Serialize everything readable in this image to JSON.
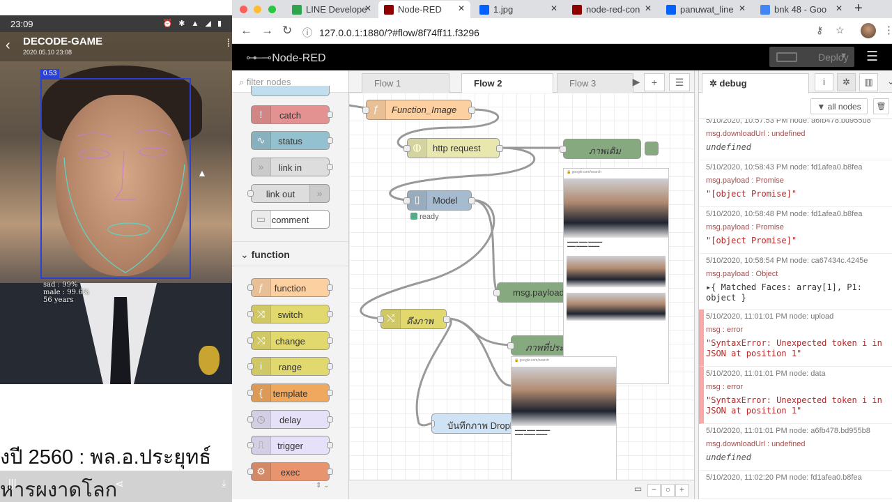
{
  "phone": {
    "time": "23:09",
    "status_icons": "⏰ ✱ ▲ ◢ ▮",
    "app_title": "DECODE-GAME",
    "app_date": "2020.05.10 23:08",
    "confidence": "0.53",
    "stats": [
      "sad : 99%",
      "male : 99.6%",
      "56 years"
    ],
    "caption_line1": "งปี 2560 : พล.อ.ประยุทธ์",
    "caption_line2": "หารผงาดโลก"
  },
  "browser": {
    "tabs": [
      {
        "label": "LINE Develope",
        "color": "#2fa44f",
        "fav": "</>"
      },
      {
        "label": "Node-RED",
        "color": "#8f0000",
        "fav": ""
      },
      {
        "label": "1.jpg",
        "color": "#0061fe",
        "fav": ""
      },
      {
        "label": "node-red-con",
        "color": "#8f0000",
        "fav": ""
      },
      {
        "label": "panuwat_line",
        "color": "#0061fe",
        "fav": ""
      },
      {
        "label": "bnk 48 - Goo",
        "color": "#4285f4",
        "fav": "G"
      }
    ],
    "url": "127.0.0.1:1880/?#flow/8f74ff11.f3296"
  },
  "nodered": {
    "logo": "Node-RED",
    "deploy": "Deploy",
    "filter_placeholder": "filter nodes",
    "category": "function",
    "palette": [
      {
        "label": "catch",
        "color": "#e49191",
        "icon": "!"
      },
      {
        "label": "status",
        "color": "#94c1d0",
        "icon": "∿"
      },
      {
        "label": "link in",
        "color": "#dddddd",
        "icon": "»"
      },
      {
        "label": "link out",
        "color": "#dddddd",
        "icon": "»"
      },
      {
        "label": "comment",
        "color": "#ffffff",
        "icon": "▭"
      },
      {
        "label": "function",
        "color": "#fdd0a2",
        "icon": "ƒ"
      },
      {
        "label": "switch",
        "color": "#e2d96e",
        "icon": "⤨"
      },
      {
        "label": "change",
        "color": "#e2d96e",
        "icon": "⤭"
      },
      {
        "label": "range",
        "color": "#e2d96e",
        "icon": "i"
      },
      {
        "label": "template",
        "color": "#f0a75e",
        "icon": "{"
      },
      {
        "label": "delay",
        "color": "#e6e0f8",
        "icon": "◷"
      },
      {
        "label": "trigger",
        "color": "#e6e0f8",
        "icon": "⎍"
      },
      {
        "label": "exec",
        "color": "#e7946f",
        "icon": "⚙"
      }
    ],
    "flow_tabs": [
      "Flow 1",
      "Flow 2",
      "Flow 3"
    ],
    "nodes": {
      "function_image": "Function_Image",
      "http_request": "http request",
      "model": "Model",
      "model_status": "ready",
      "msg_payload": "msg.payload",
      "change": "ดึงภาพ",
      "image_before": "ภาพเดิม",
      "image_after": "ภาพที่ประมวลผลแล้ว",
      "save": "บันทึกภาพ Dropbox"
    },
    "sidebar_tab": "debug",
    "all_nodes": "all nodes",
    "messages": [
      {
        "meta": "5/10/2020, 10:57:53 PM   node: a6fb478.bd955b8",
        "topic": "msg.downloadUrl : undefined",
        "value": "undefined",
        "kind": "undef",
        "err": false
      },
      {
        "meta": "5/10/2020, 10:58:43 PM   node: fd1afea0.b8fea",
        "topic": "msg.payload : Promise",
        "value": "\"[object Promise]\"",
        "kind": "str",
        "err": false
      },
      {
        "meta": "5/10/2020, 10:58:48 PM   node: fd1afea0.b8fea",
        "topic": "msg.payload : Promise",
        "value": "\"[object Promise]\"",
        "kind": "str",
        "err": false
      },
      {
        "meta": "5/10/2020, 10:58:54 PM   node: ca67434c.4245e",
        "topic": "msg.payload : Object",
        "value": "▸{ Matched Faces: array[1], P1: object }",
        "kind": "obj",
        "err": false
      },
      {
        "meta": "5/10/2020, 11:01:01 PM   node: upload",
        "topic": "msg : error",
        "value": "\"SyntaxError: Unexpected token i in JSON at position 1\"",
        "kind": "str",
        "err": true
      },
      {
        "meta": "5/10/2020, 11:01:01 PM   node: data",
        "topic": "msg : error",
        "value": "\"SyntaxError: Unexpected token i in JSON at position 1\"",
        "kind": "str",
        "err": true
      },
      {
        "meta": "5/10/2020, 11:01:01 PM   node: a6fb478.bd955b8",
        "topic": "msg.downloadUrl : undefined",
        "value": "undefined",
        "kind": "undef",
        "err": false
      },
      {
        "meta": "5/10/2020, 11:02:20 PM   node: fd1afea0.b8fea",
        "topic": "",
        "value": "",
        "kind": "str",
        "err": false
      }
    ]
  },
  "colors": {
    "accent": "#8f0000",
    "node_orange": "#fdd0a2",
    "node_yellow": "#e2d96e",
    "node_grey": "#a6bbcf",
    "node_green": "#87a980"
  }
}
